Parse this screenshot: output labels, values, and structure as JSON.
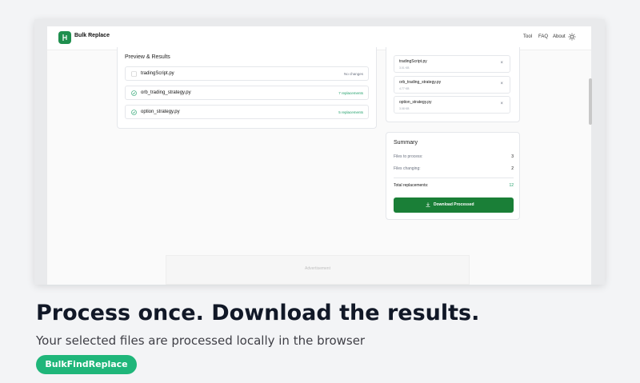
{
  "app": {
    "brand": "Bulk Replace",
    "nav": [
      "Tool",
      "FAQ",
      "About"
    ]
  },
  "preview": {
    "title": "Preview & Results",
    "rows": [
      {
        "name": "tradingScript.py",
        "status": "No changes",
        "changed": false
      },
      {
        "name": "orb_trading_strategy.py",
        "status": "7 replacements",
        "changed": true
      },
      {
        "name": "option_strategy.py",
        "status": "5 replacements",
        "changed": true
      }
    ]
  },
  "files": [
    {
      "name": "tradingScript.py",
      "size": "3.01 KB"
    },
    {
      "name": "orb_trading_strategy.py",
      "size": "4.77 KB"
    },
    {
      "name": "option_strategy.py",
      "size": "3.08 KB"
    }
  ],
  "summary": {
    "title": "Summary",
    "to_process_label": "Files to process:",
    "to_process_value": "3",
    "changing_label": "Files changing:",
    "changing_value": "2",
    "total_label": "Total replacements:",
    "total_value": "12",
    "download_label": "Download Processed"
  },
  "ad": "Advertisement",
  "caption": {
    "headline": "Process once. Download the results.",
    "subline": "Your selected files are processed locally in the browser",
    "badge": "BulkFindReplace"
  },
  "colors": {
    "accent": "#1a7f37",
    "success": "#22a06b",
    "badge": "#1fb67a"
  }
}
